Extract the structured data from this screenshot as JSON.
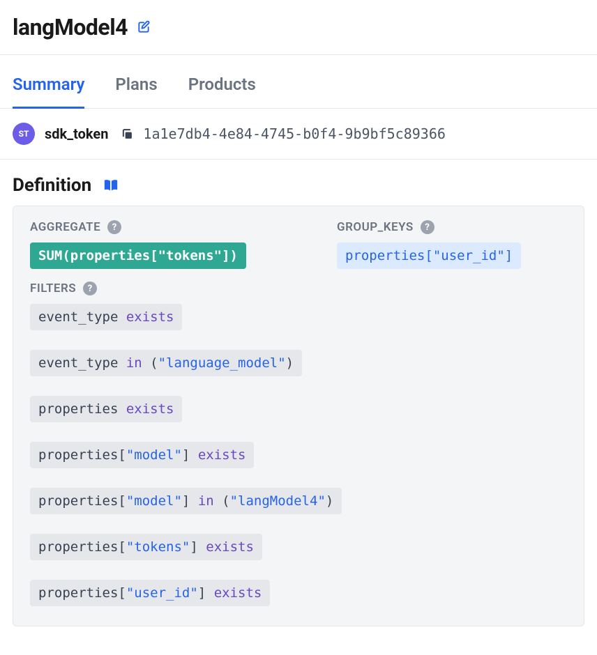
{
  "header": {
    "title": "langModel4"
  },
  "tabs": [
    {
      "id": "summary",
      "label": "Summary",
      "active": true
    },
    {
      "id": "plans",
      "label": "Plans",
      "active": false
    },
    {
      "id": "products",
      "label": "Products",
      "active": false
    }
  ],
  "token": {
    "avatar_initials": "ST",
    "label": "sdk_token",
    "value": "1a1e7db4-4e84-4745-b0f4-9b9bf5c89366"
  },
  "definition": {
    "title": "Definition",
    "labels": {
      "aggregate": "AGGREGATE",
      "group_keys": "GROUP_KEYS",
      "filters": "FILTERS"
    },
    "aggregate": {
      "fn": "SUM",
      "field": "properties",
      "key": "\"tokens\""
    },
    "group_keys": [
      {
        "field": "properties",
        "key": "\"user_id\""
      }
    ],
    "filters": [
      {
        "tokens": [
          {
            "t": "event_type",
            "c": "field"
          },
          {
            "t": " ",
            "c": "punct"
          },
          {
            "t": "exists",
            "c": "key"
          }
        ]
      },
      {
        "tokens": [
          {
            "t": "event_type",
            "c": "field"
          },
          {
            "t": " ",
            "c": "punct"
          },
          {
            "t": "in",
            "c": "key"
          },
          {
            "t": " (",
            "c": "punct"
          },
          {
            "t": "\"language_model\"",
            "c": "str"
          },
          {
            "t": ")",
            "c": "punct"
          }
        ]
      },
      {
        "tokens": [
          {
            "t": "properties",
            "c": "field"
          },
          {
            "t": " ",
            "c": "punct"
          },
          {
            "t": "exists",
            "c": "key"
          }
        ]
      },
      {
        "tokens": [
          {
            "t": "properties",
            "c": "field"
          },
          {
            "t": "[",
            "c": "punct"
          },
          {
            "t": "\"model\"",
            "c": "str"
          },
          {
            "t": "]",
            "c": "punct"
          },
          {
            "t": " ",
            "c": "punct"
          },
          {
            "t": "exists",
            "c": "key"
          }
        ]
      },
      {
        "tokens": [
          {
            "t": "properties",
            "c": "field"
          },
          {
            "t": "[",
            "c": "punct"
          },
          {
            "t": "\"model\"",
            "c": "str"
          },
          {
            "t": "]",
            "c": "punct"
          },
          {
            "t": " ",
            "c": "punct"
          },
          {
            "t": "in",
            "c": "key"
          },
          {
            "t": " (",
            "c": "punct"
          },
          {
            "t": "\"langModel4\"",
            "c": "str"
          },
          {
            "t": ")",
            "c": "punct"
          }
        ]
      },
      {
        "tokens": [
          {
            "t": "properties",
            "c": "field"
          },
          {
            "t": "[",
            "c": "punct"
          },
          {
            "t": "\"tokens\"",
            "c": "str"
          },
          {
            "t": "]",
            "c": "punct"
          },
          {
            "t": " ",
            "c": "punct"
          },
          {
            "t": "exists",
            "c": "key"
          }
        ]
      },
      {
        "tokens": [
          {
            "t": "properties",
            "c": "field"
          },
          {
            "t": "[",
            "c": "punct"
          },
          {
            "t": "\"user_id\"",
            "c": "str"
          },
          {
            "t": "]",
            "c": "punct"
          },
          {
            "t": " ",
            "c": "punct"
          },
          {
            "t": "exists",
            "c": "key"
          }
        ]
      }
    ]
  }
}
